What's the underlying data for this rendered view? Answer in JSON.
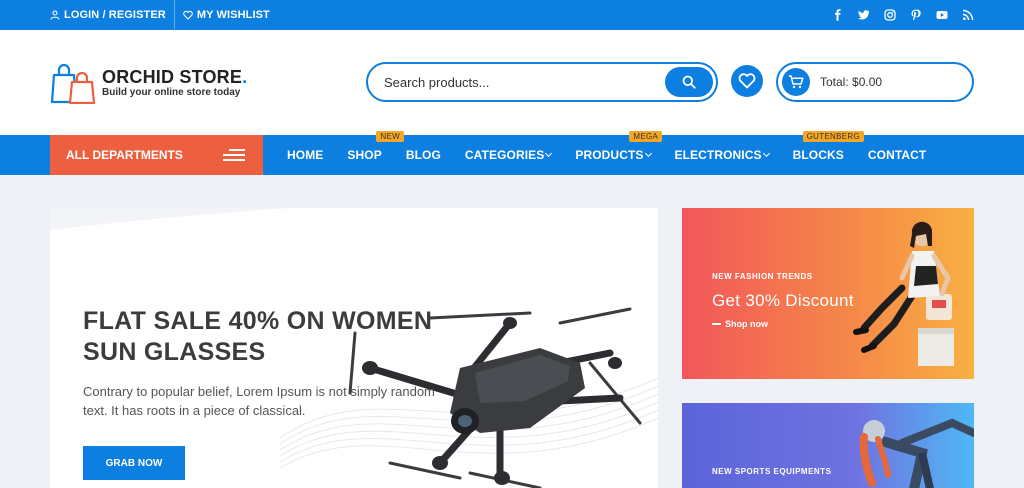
{
  "topbar": {
    "login_label": "LOGIN / REGISTER",
    "wishlist_label": "MY WISHLIST",
    "social_icons": [
      "facebook-icon",
      "twitter-icon",
      "instagram-icon",
      "pinterest-icon",
      "youtube-icon",
      "rss-icon"
    ]
  },
  "header": {
    "logo_name": "ORCHID STORE",
    "logo_dot": ".",
    "logo_tagline": "Build your online store today",
    "search_placeholder": "Search products...",
    "cart_total": "Total: $0.00"
  },
  "nav": {
    "departments_label": "ALL DEPARTMENTS",
    "items": [
      {
        "label": "HOME",
        "has_dropdown": false,
        "badge": ""
      },
      {
        "label": "SHOP",
        "has_dropdown": false,
        "badge": "NEW"
      },
      {
        "label": "BLOG",
        "has_dropdown": false,
        "badge": ""
      },
      {
        "label": "CATEGORIES",
        "has_dropdown": true,
        "badge": ""
      },
      {
        "label": "PRODUCTS",
        "has_dropdown": true,
        "badge": "MEGA"
      },
      {
        "label": "ELECTRONICS",
        "has_dropdown": true,
        "badge": ""
      },
      {
        "label": "BLOCKS",
        "has_dropdown": false,
        "badge": "GUTENBERG"
      },
      {
        "label": "CONTACT",
        "has_dropdown": false,
        "badge": ""
      }
    ]
  },
  "banner": {
    "title": "FLAT SALE 40% ON WOMEN SUN GLASSES",
    "description": "Contrary to popular belief, Lorem Ipsum is not simply random text. It has roots in a piece of classical.",
    "button_label": "GRAB NOW"
  },
  "promos": [
    {
      "kicker": "NEW FASHION TRENDS",
      "title": "Get 30% Discount",
      "link": "Shop now"
    },
    {
      "kicker": "NEW SPORTS EQUIPMENTS"
    }
  ],
  "colors": {
    "primary": "#0c7fe0",
    "accent": "#ec5f3f",
    "badge": "#f5a623"
  }
}
